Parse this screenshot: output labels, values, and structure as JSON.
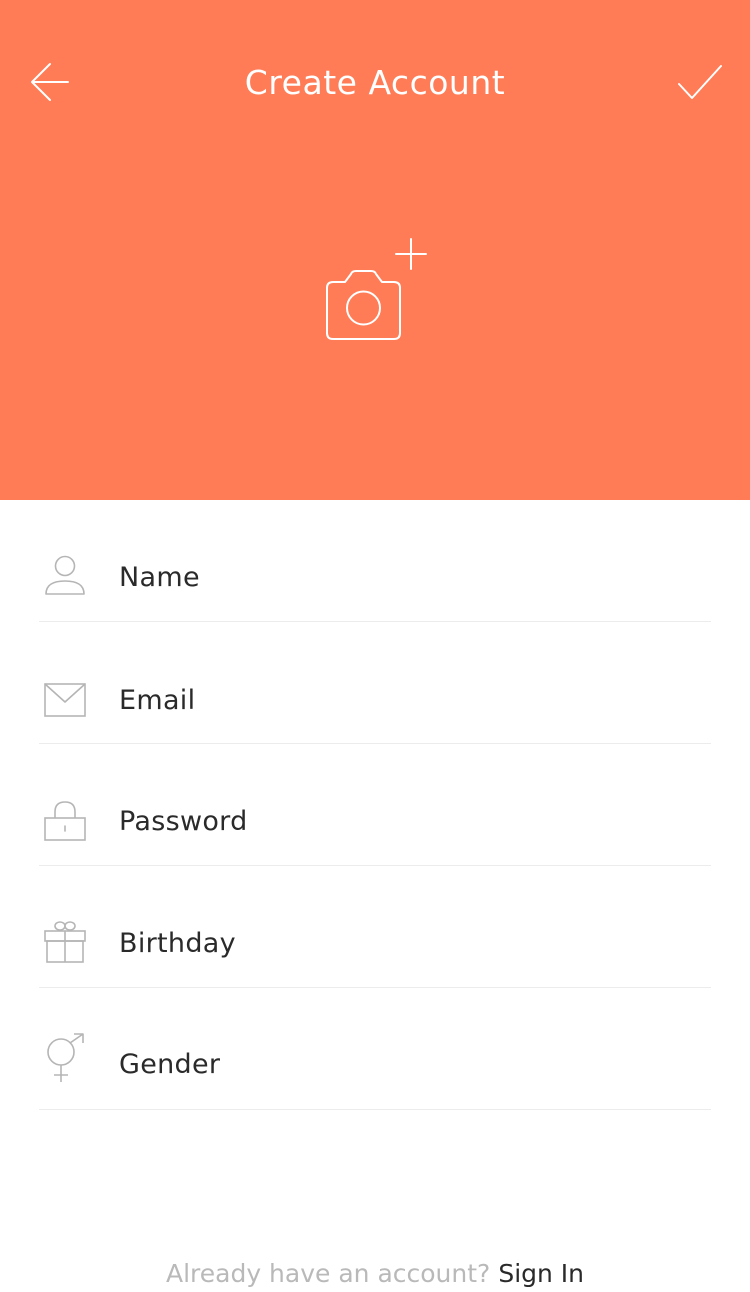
{
  "header": {
    "title": "Create Account",
    "back_icon": "arrow-left-icon",
    "confirm_icon": "checkmark-icon",
    "photo_icon": "camera-add-icon",
    "background_color": "#FF7C56"
  },
  "form": {
    "fields": [
      {
        "label": "Name",
        "icon": "person-icon"
      },
      {
        "label": "Email",
        "icon": "envelope-icon"
      },
      {
        "label": "Password",
        "icon": "lock-icon"
      },
      {
        "label": "Birthday",
        "icon": "gift-icon"
      },
      {
        "label": "Gender",
        "icon": "gender-icon"
      }
    ]
  },
  "footer": {
    "prompt": "Already have an account?",
    "link_label": "Sign In"
  }
}
